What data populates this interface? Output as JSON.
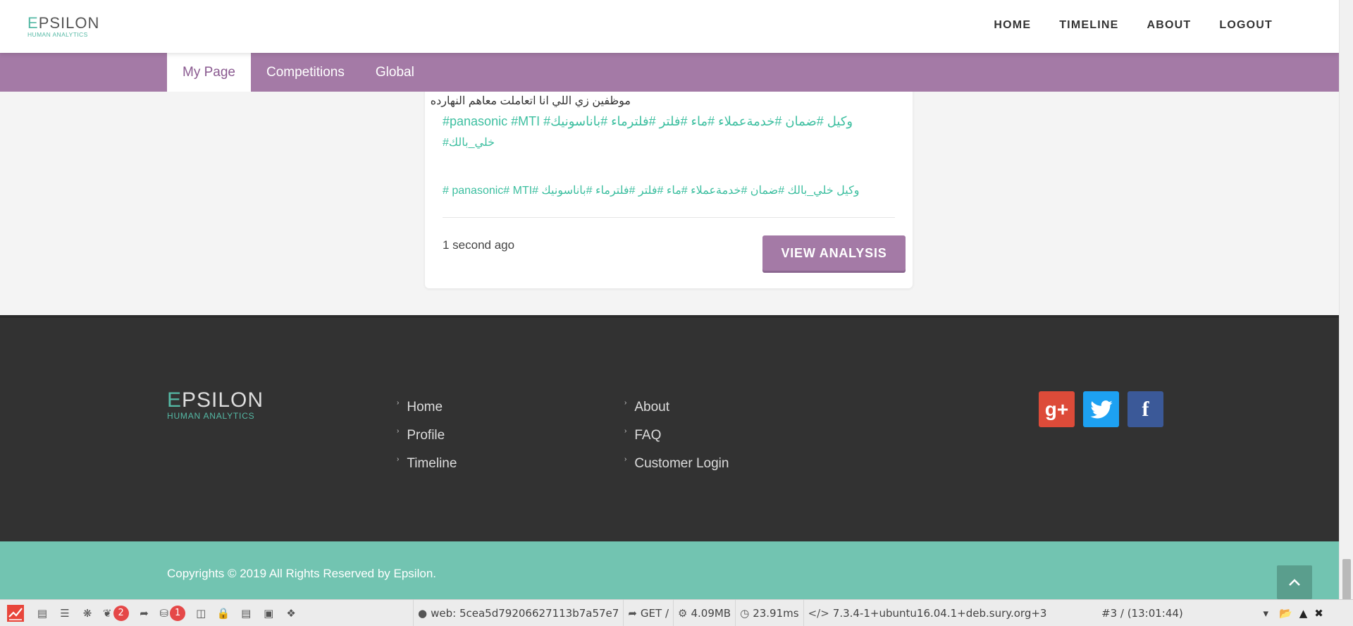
{
  "brand": {
    "name_first": "E",
    "name_rest": "PSILON",
    "tagline": "HUMAN ANALYTICS",
    "accent": "#55b9a5",
    "purple": "#a47aa6"
  },
  "nav": {
    "items": [
      "HOME",
      "TIMELINE",
      "ABOUT",
      "LOGOUT"
    ]
  },
  "subnav": {
    "tabs": [
      "My Page",
      "Competitions",
      "Global"
    ],
    "active": "My Page"
  },
  "post": {
    "text": "موظفين زي اللي انا اتعاملت معاهم النهارده",
    "tags_line1": "#panasonic #MTI #وكيل #ضمان #خدمةعملاء #ماء #فلتر #فلترماء #باناسونيك",
    "tags_line1b": "#خلي_بالك",
    "tags_line2": "# panasonic# MTI# وكيل خلي_بالك #ضمان #خدمةعملاء #ماء #فلتر #فلترماء #باناسونيك",
    "time": "1 second ago",
    "button": "VIEW ANALYSIS"
  },
  "footer": {
    "col1": [
      "Home",
      "Profile",
      "Timeline"
    ],
    "col2": [
      "About",
      "FAQ",
      "Customer Login"
    ],
    "social": {
      "google": "g+",
      "facebook": "f"
    },
    "copyright": "Copyrights © 2019 All Rights Reserved by Epsilon."
  },
  "debugbar": {
    "badge_logs": "2",
    "badge_db": "1",
    "web_label": "web:",
    "web_hash": "5cea5d79206627113b7a57e7",
    "method": "GET",
    "path": "/",
    "memory": "4.09MB",
    "time": "23.91ms",
    "php": "7.3.4-1+ubuntu16.04.1+deb.sury.org+3",
    "request_select": "#3 / (13:01:44)"
  }
}
